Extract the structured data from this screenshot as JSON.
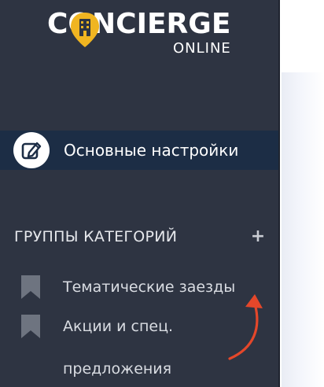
{
  "logo": {
    "word": "CONCIERGE",
    "sub": "ONLINE",
    "accent": "#f0b521"
  },
  "menu": {
    "active_item": {
      "label": "Основные настройки",
      "icon": "edit-icon"
    }
  },
  "categories": {
    "title": "ГРУППЫ КАТЕГОРИЙ",
    "add_icon": "plus-icon",
    "items": [
      {
        "label": "Тематические заезды",
        "icon": "bookmark-icon"
      },
      {
        "label_lines": [
          "Акции и спец.",
          "предложения"
        ],
        "icon": "bookmark-icon"
      }
    ]
  },
  "colors": {
    "sidebar_bg": "#2e3442",
    "active_bg": "#1c2d45",
    "annotation_arrow": "#e4472a"
  }
}
